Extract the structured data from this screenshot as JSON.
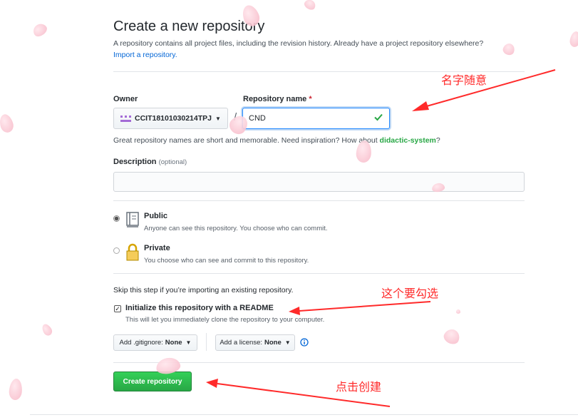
{
  "header": {
    "title": "Create a new repository",
    "subtitle": "A repository contains all project files, including the revision history. Already have a project repository elsewhere?",
    "import_link": "Import a repository."
  },
  "owner": {
    "label": "Owner",
    "value": "CCIT18101030214TPJ"
  },
  "repo_name": {
    "label": "Repository name",
    "required_mark": "*",
    "value": "CND",
    "separator": "/"
  },
  "hint": {
    "prefix": "Great repository names are short and memorable. Need inspiration? How about ",
    "suggestion": "didactic-system",
    "suffix": "?"
  },
  "description": {
    "label": "Description",
    "optional": "(optional)",
    "value": ""
  },
  "visibility": {
    "selected": "public",
    "public": {
      "title": "Public",
      "note": "Anyone can see this repository. You choose who can commit."
    },
    "private": {
      "title": "Private",
      "note": "You choose who can see and commit to this repository."
    }
  },
  "init": {
    "skip_text": "Skip this step if you’re importing an existing repository.",
    "checked": true,
    "title": "Initialize this repository with a README",
    "note": "This will let you immediately clone the repository to your computer."
  },
  "gitignore": {
    "label": "Add .gitignore:",
    "value": "None"
  },
  "license": {
    "label": "Add a license:",
    "value": "None"
  },
  "submit": {
    "label": "Create repository"
  },
  "annotations": {
    "name_note": "名字随意",
    "check_note": "这个要勾选",
    "create_note": "点击创建",
    "arrow_color": "#ff2a2a"
  },
  "colors": {
    "link": "#0366d6",
    "primary_button": "#28a745",
    "success_check": "#28a745",
    "required": "#cb2431"
  }
}
